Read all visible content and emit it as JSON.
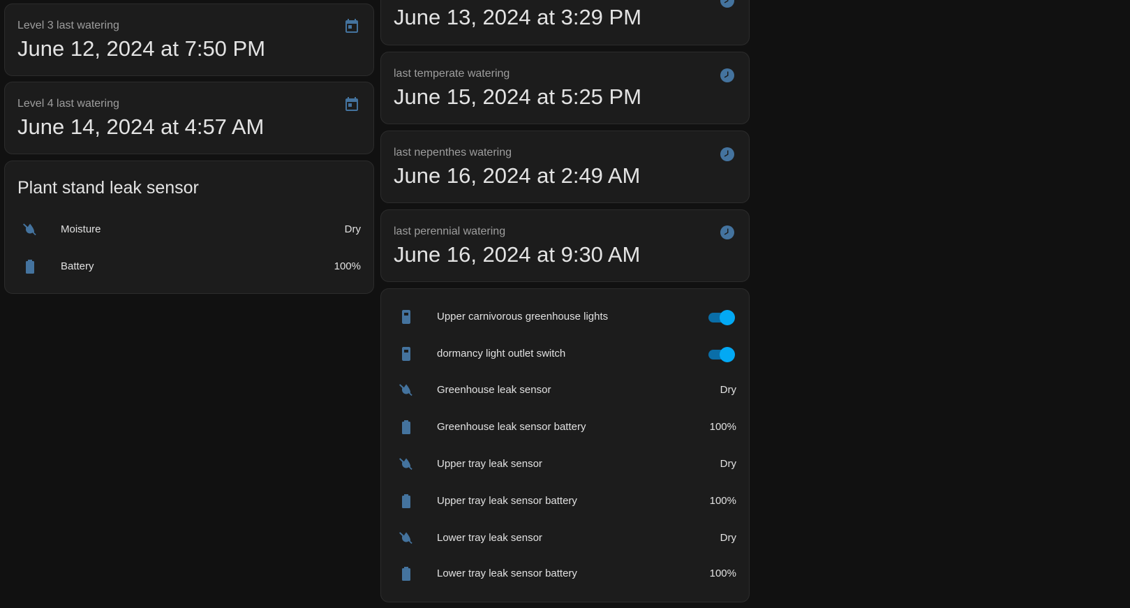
{
  "colors": {
    "background": "#111111",
    "card": "#1c1c1c",
    "icon": "#44739e",
    "toggle_on": "#03a9f4"
  },
  "left_column": {
    "level3": {
      "label": "Level 3 last watering",
      "value": "June 12, 2024 at 7:50 PM",
      "icon": "calendar-icon"
    },
    "level4": {
      "label": "Level 4 last watering",
      "value": "June 14, 2024 at 4:57 AM",
      "icon": "calendar-icon"
    },
    "leak_card": {
      "title": "Plant stand leak sensor",
      "rows": [
        {
          "name": "Moisture",
          "state": "Dry",
          "icon": "water-off-icon"
        },
        {
          "name": "Battery",
          "state": "100%",
          "icon": "battery-icon"
        }
      ]
    }
  },
  "right_column": {
    "top_partial": {
      "value": "June 13, 2024 at 3:29 PM",
      "icon": "clock-icon"
    },
    "temperate": {
      "label": "last temperate watering",
      "value": "June 15, 2024 at 5:25 PM",
      "icon": "clock-icon"
    },
    "nepenthes": {
      "label": "last nepenthes watering",
      "value": "June 16, 2024 at 2:49 AM",
      "icon": "clock-icon"
    },
    "perennial": {
      "label": "last perennial watering",
      "value": "June 16, 2024 at 9:30 AM",
      "icon": "clock-icon"
    },
    "entities": [
      {
        "name": "Upper carnivorous greenhouse lights",
        "type": "toggle",
        "on": true,
        "icon": "light-switch-icon"
      },
      {
        "name": "dormancy light outlet switch",
        "type": "toggle",
        "on": true,
        "icon": "light-switch-icon"
      },
      {
        "name": "Greenhouse leak sensor",
        "state": "Dry",
        "icon": "water-off-icon"
      },
      {
        "name": "Greenhouse leak sensor battery",
        "state": "100%",
        "icon": "battery-icon"
      },
      {
        "name": "Upper tray leak sensor",
        "state": "Dry",
        "icon": "water-off-icon"
      },
      {
        "name": "Upper tray leak sensor battery",
        "state": "100%",
        "icon": "battery-icon"
      },
      {
        "name": "Lower tray leak sensor",
        "state": "Dry",
        "icon": "water-off-icon"
      },
      {
        "name": "Lower tray leak sensor battery",
        "state": "100%",
        "icon": "battery-icon"
      }
    ]
  }
}
